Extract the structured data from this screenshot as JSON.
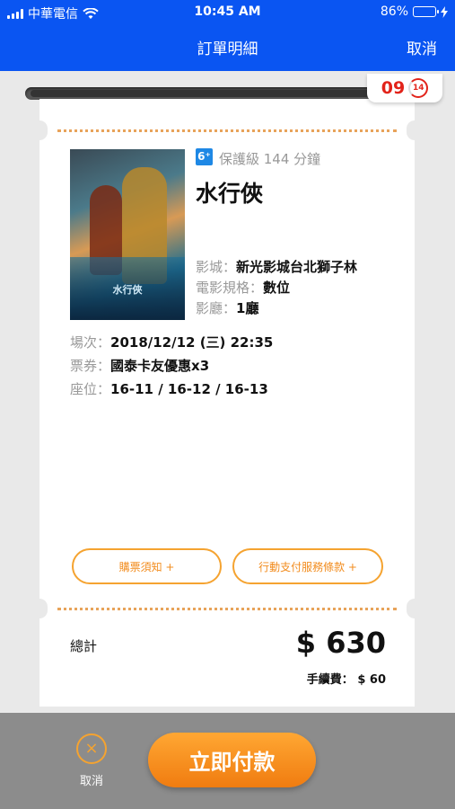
{
  "status": {
    "carrier": "中華電信",
    "time": "10:45 AM",
    "battery": "86%",
    "battery_level": 0.86
  },
  "nav": {
    "title": "訂單明細",
    "cancel_label": "取消"
  },
  "timer": {
    "minutes": "09",
    "seconds": "14"
  },
  "movie": {
    "rating_icon": "6⁺",
    "meta": "保護級 144 分鐘",
    "title": "水行俠",
    "poster_title": "水行俠",
    "cinema_label": "影城：",
    "cinema_value": "新光影城台北獅子林",
    "format_label": "電影規格：",
    "format_value": "數位",
    "hall_label": "影廳：",
    "hall_value": "1廳"
  },
  "order": {
    "session_label": "場次：",
    "session_value": "2018/12/12 (三) 22:35",
    "ticket_label": "票券：",
    "ticket_value": "國泰卡友優惠x3",
    "seat_label": "座位：",
    "seat_value": "16-11 / 16-12 / 16-13"
  },
  "buttons": {
    "purchase_notice": "購票須知 +",
    "payment_terms": "行動支付服務條款 +"
  },
  "total": {
    "label": "總計",
    "amount": "$ 630",
    "fee": "手續費： $ 60"
  },
  "bottom": {
    "cancel_label": "取消",
    "pay_label": "立即付款"
  },
  "colors": {
    "nav_blue": "#0a55f2",
    "accent_orange": "#f5a330",
    "timer_red": "#e2231a"
  }
}
